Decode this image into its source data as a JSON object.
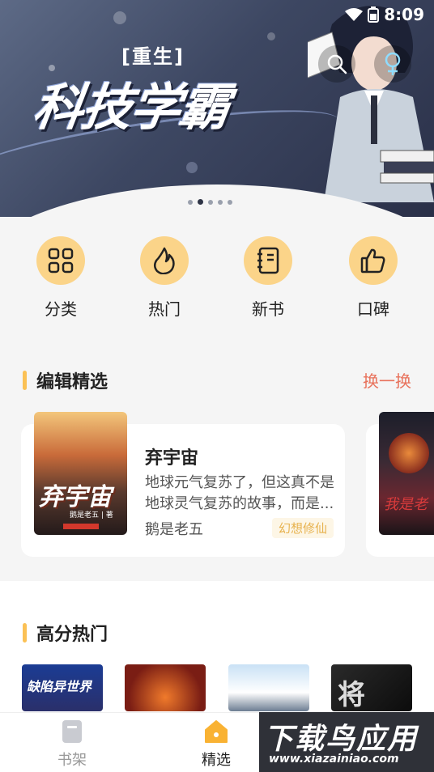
{
  "status": {
    "time": "8:09"
  },
  "banner": {
    "subtitle": "[重生]",
    "title": "科技学霸",
    "active_dot": 2,
    "dot_count": 5
  },
  "categories": [
    {
      "label": "分类",
      "icon": "grid-icon"
    },
    {
      "label": "热门",
      "icon": "flame-icon"
    },
    {
      "label": "新书",
      "icon": "notebook-icon"
    },
    {
      "label": "口碑",
      "icon": "thumbs-up-icon"
    }
  ],
  "editor_picks": {
    "title": "编辑精选",
    "refresh_label": "换一换",
    "book": {
      "name": "弃宇宙",
      "description": "地球元气复苏了，但这真不是地球灵气复苏的故事，而是...",
      "author": "鹅是老五",
      "tag": "幻想修仙",
      "cover_title": "弃宇宙",
      "cover_author": "鹅是老五 | 著"
    },
    "next_cover_title": "我是老"
  },
  "hot": {
    "title": "高分热门",
    "cover1_title": "缺陷异世界",
    "cover4_title": "将"
  },
  "nav": {
    "shelf": "书架",
    "picks": "精选"
  },
  "watermark": {
    "big": "下载鸟应用",
    "small": "www.xiazainiao.com"
  },
  "colors": {
    "accent": "#fbd489",
    "section_bar": "#fbc155",
    "refresh": "#e8725c",
    "tag": "#e7b24e"
  }
}
